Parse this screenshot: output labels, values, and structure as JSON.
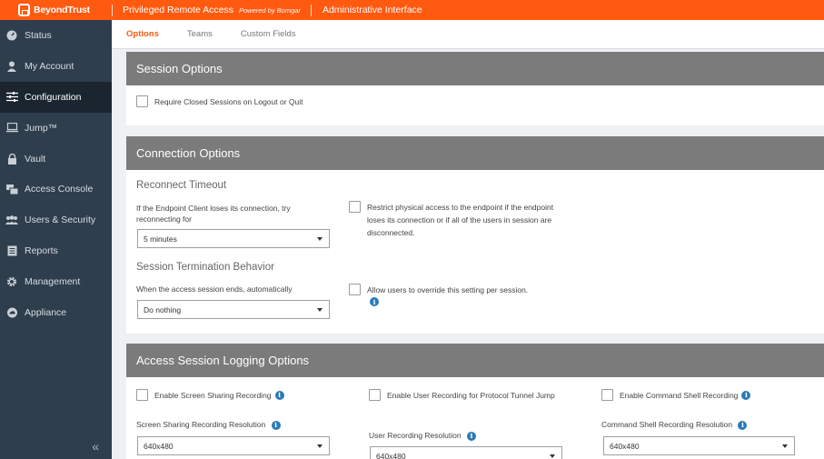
{
  "topbar": {
    "brand": "BeyondTrust",
    "product": "Privileged Remote Access",
    "powered_by": "Powered by Bomgar",
    "interface": "Administrative Interface"
  },
  "sidebar": {
    "items": [
      {
        "label": "Status",
        "icon": "gauge-icon",
        "active": false
      },
      {
        "label": "My Account",
        "icon": "user-icon",
        "active": false
      },
      {
        "label": "Configuration",
        "icon": "sliders-icon",
        "active": true
      },
      {
        "label": "Jump™",
        "icon": "laptop-icon",
        "active": false
      },
      {
        "label": "Vault",
        "icon": "lock-icon",
        "active": false
      },
      {
        "label": "Access Console",
        "icon": "console-icon",
        "active": false
      },
      {
        "label": "Users & Security",
        "icon": "users-icon",
        "active": false
      },
      {
        "label": "Reports",
        "icon": "report-icon",
        "active": false
      },
      {
        "label": "Management",
        "icon": "gear-icon",
        "active": false
      },
      {
        "label": "Appliance",
        "icon": "cloud-icon",
        "active": false
      }
    ],
    "collapse_glyph": "«"
  },
  "tabs": [
    {
      "label": "Options",
      "active": true
    },
    {
      "label": "Teams",
      "active": false
    },
    {
      "label": "Custom Fields",
      "active": false
    }
  ],
  "session_options": {
    "title": "Session Options",
    "require_closed": "Require Closed Sessions on Logout or Quit"
  },
  "connection_options": {
    "title": "Connection Options",
    "reconnect_heading": "Reconnect Timeout",
    "reconnect_label": "If the Endpoint Client loses its connection, try reconnecting for",
    "reconnect_value": "5 minutes",
    "restrict_label": "Restrict physical access to the endpoint if the endpoint loses its connection or if all of the users in session are disconnected.",
    "termination_heading": "Session Termination Behavior",
    "termination_label": "When the access session ends, automatically",
    "termination_value": "Do nothing",
    "override_label": "Allow users to override this setting per session."
  },
  "logging_options": {
    "title": "Access Session Logging Options",
    "screen_sharing_recording": "Enable Screen Sharing Recording",
    "user_recording": "Enable User Recording for Protocol Tunnel Jump",
    "command_shell_recording": "Enable Command Shell Recording",
    "screen_sharing_resolution_label": "Screen Sharing Recording Resolution",
    "screen_sharing_resolution_value": "640x480",
    "user_resolution_label": "User Recording Resolution",
    "user_resolution_value": "640x480",
    "command_shell_resolution_label": "Command Shell Recording Resolution",
    "command_shell_resolution_value": "640x480"
  },
  "info_glyph": "i"
}
